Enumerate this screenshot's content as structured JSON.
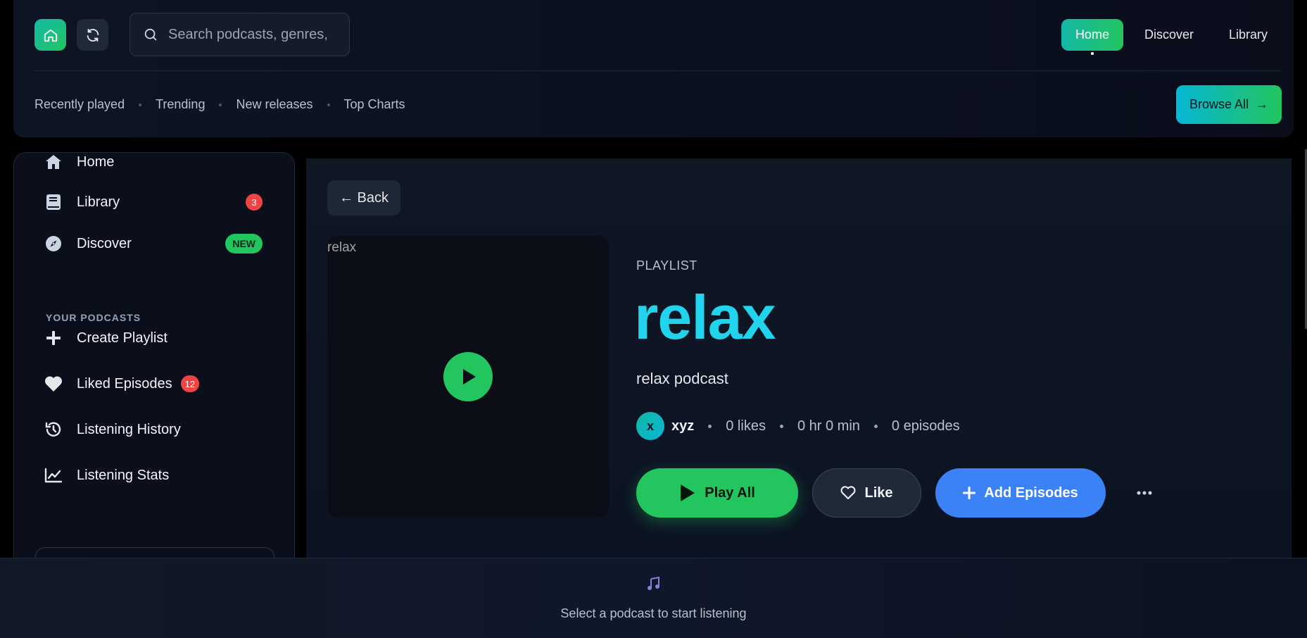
{
  "header": {
    "search_placeholder": "Search podcasts, genres, c",
    "nav": [
      "Home",
      "Discover",
      "Library"
    ],
    "active_nav": "Home",
    "subnav": [
      "Recently played",
      "Trending",
      "New releases",
      "Top Charts"
    ],
    "browse_label": "Browse All",
    "browse_arrow": "→"
  },
  "sidebar": {
    "items": [
      {
        "label": "Home",
        "icon": "home-icon"
      },
      {
        "label": "Library",
        "icon": "book-icon",
        "badge": "3"
      },
      {
        "label": "Discover",
        "icon": "compass-icon",
        "badge": "NEW"
      }
    ],
    "section_title": "YOUR PODCASTS",
    "podcast_items": [
      {
        "label": "Create Playlist",
        "icon": "plus-icon"
      },
      {
        "label": "Liked Episodes",
        "icon": "heart-icon",
        "badge": "12"
      },
      {
        "label": "Listening History",
        "icon": "history-icon"
      },
      {
        "label": "Listening Stats",
        "icon": "chart-line-icon"
      }
    ]
  },
  "main": {
    "back_label": "← Back",
    "cover_label": "relax",
    "kind": "PLAYLIST",
    "title": "relax",
    "description": "relax podcast",
    "owner_initial": "x",
    "owner": "xyz",
    "likes": "0 likes",
    "duration": "0 hr 0 min",
    "episodes": "0 episodes",
    "play_all": "Play All",
    "like": "Like",
    "add_episodes": "Add Episodes"
  },
  "player": {
    "message": "Select a podcast to start listening"
  },
  "colors": {
    "accent_teal": "#14b8a6",
    "accent_green": "#22c55e",
    "title_cyan": "#22d3ee",
    "add_blue": "#3b82f6",
    "badge_red": "#ef4444",
    "note_purple": "#8b7fd8"
  }
}
